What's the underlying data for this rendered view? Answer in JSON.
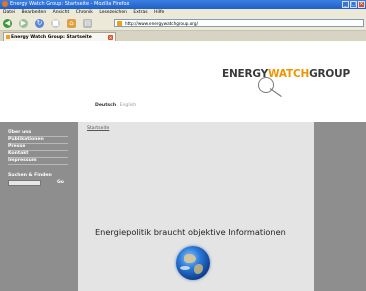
{
  "window": {
    "title": "Energy Watch Group: Startseite - Mozilla Firefox"
  },
  "menu": [
    "Datei",
    "Bearbeiten",
    "Ansicht",
    "Chronik",
    "Lesezeichen",
    "Extras",
    "Hilfe"
  ],
  "address": {
    "url": "http://www.energywatchgroup.org/"
  },
  "tab": {
    "label": "Energy Watch Group: Startseite"
  },
  "logo": {
    "part1": "ENERGY",
    "part2": "WATCH",
    "part3": "GROUP",
    "color_watch": "#f29400"
  },
  "languages": {
    "active": "Deutsch",
    "other": "English"
  },
  "sidebar": {
    "items": [
      "Über uns",
      "Publikationen",
      "Presse",
      "Kontakt",
      "Impressum"
    ],
    "search_label": "Suchen & Finden",
    "go_label": "Go"
  },
  "content": {
    "breadcrumb": "Startseite",
    "headline": "Energiepolitik braucht objektive Informationen"
  }
}
